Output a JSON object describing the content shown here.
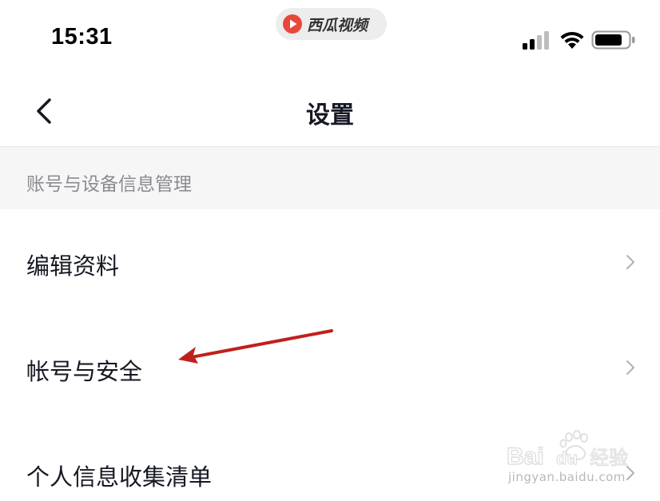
{
  "status_bar": {
    "time": "15:31",
    "app_name": "西瓜视频",
    "app_logo_icon": "xigua-logo-icon",
    "signal_icon": "cellular-signal-icon",
    "wifi_icon": "wifi-icon",
    "battery_icon": "battery-icon"
  },
  "nav": {
    "back_icon": "chevron-left-icon",
    "title": "设置"
  },
  "section": {
    "header": "账号与设备信息管理"
  },
  "menu": {
    "items": [
      {
        "label": "编辑资料",
        "icon": "chevron-right-icon"
      },
      {
        "label": "帐号与安全",
        "icon": "chevron-right-icon"
      },
      {
        "label": "个人信息收集清单",
        "icon": "chevron-right-icon"
      }
    ]
  },
  "annotation": {
    "arrow_color": "#c0201d"
  },
  "watermark": {
    "brand": "Baidu经验",
    "url": "jingyan.baidu.com"
  },
  "colors": {
    "text_primary": "#161823",
    "text_secondary": "#8a8b91",
    "section_bg": "#f6f6f6",
    "logo_red": "#e9473b"
  }
}
